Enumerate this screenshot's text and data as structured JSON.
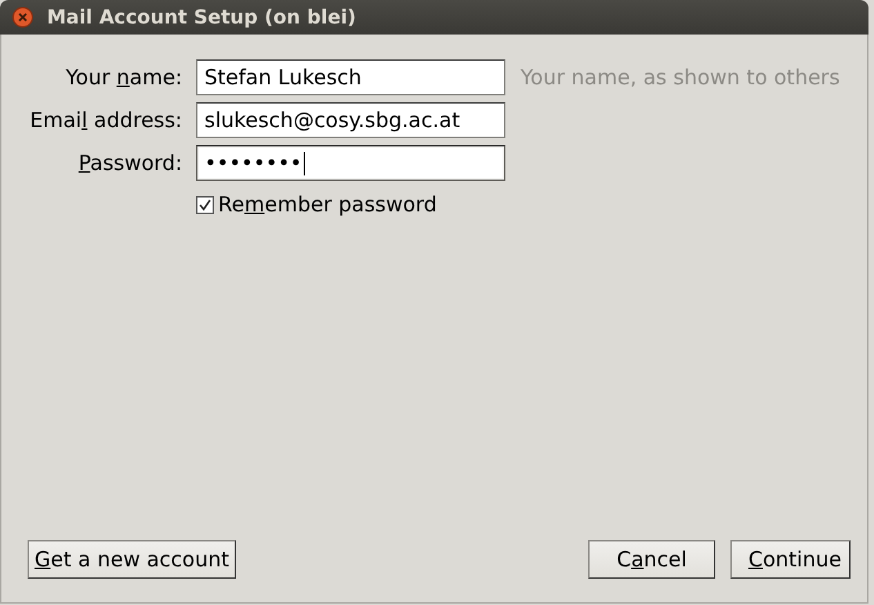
{
  "window": {
    "title": "Mail Account Setup (on blei)"
  },
  "fields": [
    {
      "label": {
        "before": "Your ",
        "access_key": "n",
        "after": "ame:"
      },
      "value": "Stefan Lukesch",
      "hint": "Your name, as shown to others",
      "focused": false
    },
    {
      "label": {
        "before": "Emai",
        "access_key": "l",
        "after": " address:"
      },
      "value": "slukesch@cosy.sbg.ac.at",
      "focused": false
    },
    {
      "label": {
        "access_key": "P",
        "after": "assword:"
      },
      "value": "••••••••",
      "focused": true
    }
  ],
  "remember_password": {
    "label": {
      "before": "Re",
      "access_key": "m",
      "after": "ember password"
    },
    "checked": true
  },
  "buttons": [
    {
      "label": {
        "access_key": "G",
        "after": "et a new account"
      },
      "kind": "left"
    },
    {
      "label": {
        "before": "C",
        "access_key": "a",
        "after": "ncel"
      },
      "kind": "right"
    },
    {
      "label": {
        "access_key": "C",
        "after": "ontinue"
      },
      "kind": "right"
    }
  ]
}
